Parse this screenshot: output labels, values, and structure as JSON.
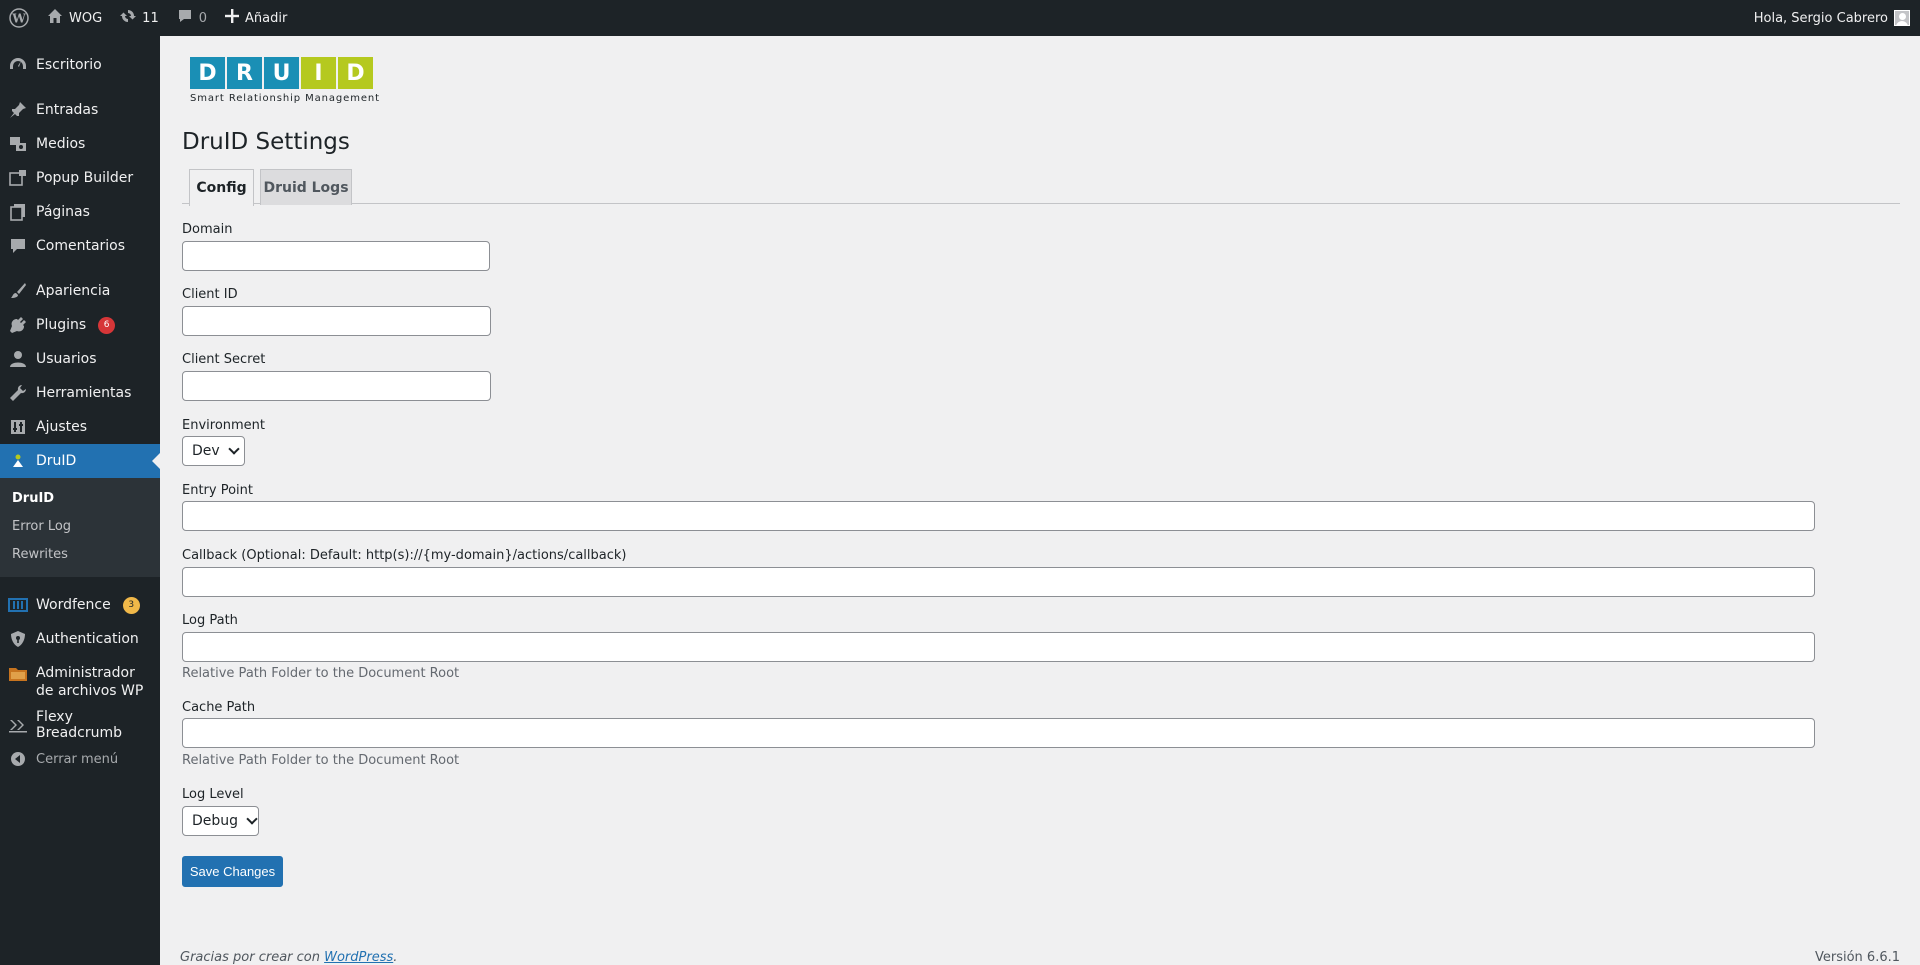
{
  "adminbar": {
    "site_name": "WOG",
    "updates_count": "11",
    "comments_count": "0",
    "add_new": "Añadir",
    "greeting": "Hola, Sergio Cabrero"
  },
  "sidebar": {
    "items": [
      {
        "label": "Escritorio",
        "icon": "dashboard-icon"
      },
      {
        "label": "Entradas",
        "icon": "pin-icon"
      },
      {
        "label": "Medios",
        "icon": "media-icon"
      },
      {
        "label": "Popup Builder",
        "icon": "popup-icon"
      },
      {
        "label": "Páginas",
        "icon": "pages-icon"
      },
      {
        "label": "Comentarios",
        "icon": "comment-icon"
      },
      {
        "label": "Apariencia",
        "icon": "brush-icon"
      },
      {
        "label": "Plugins",
        "icon": "plugin-icon",
        "badge": "6"
      },
      {
        "label": "Usuarios",
        "icon": "user-icon"
      },
      {
        "label": "Herramientas",
        "icon": "wrench-icon"
      },
      {
        "label": "Ajustes",
        "icon": "settings-icon"
      },
      {
        "label": "DruID",
        "icon": "druid-icon"
      }
    ],
    "submenu": [
      "DruID",
      "Error Log",
      "Rewrites"
    ],
    "items2": [
      {
        "label": "Wordfence",
        "icon": "wordfence-icon",
        "badge": "3"
      },
      {
        "label": "Authentication",
        "icon": "shield-icon"
      },
      {
        "label": "Administrador de archivos WP",
        "icon": "folder-icon"
      },
      {
        "label": "Flexy Breadcrumb",
        "icon": "breadcrumb-icon"
      }
    ],
    "collapse": "Cerrar menú"
  },
  "logo": {
    "letters": [
      "D",
      "R",
      "U",
      "I",
      "D"
    ],
    "colors": [
      "#1a8fb5",
      "#1a8fb5",
      "#1a8fb5",
      "#b5c91f",
      "#b5c91f"
    ],
    "tagline": "Smart Relationship Management"
  },
  "page": {
    "title": "DruID Settings",
    "tabs": [
      "Config",
      "Druid Logs"
    ]
  },
  "form": {
    "domain_label": "Domain",
    "client_id_label": "Client ID",
    "client_secret_label": "Client Secret",
    "environment_label": "Environment",
    "environment_value": "Dev",
    "entry_point_label": "Entry Point",
    "callback_label": "Callback (Optional: Default: http(s)://{my-domain}/actions/callback)",
    "log_path_label": "Log Path",
    "log_path_desc": "Relative Path Folder to the Document Root",
    "cache_path_label": "Cache Path",
    "cache_path_desc": "Relative Path Folder to the Document Root",
    "log_level_label": "Log Level",
    "log_level_value": "Debug",
    "save_label": "Save Changes"
  },
  "footer": {
    "thanks_prefix": "Gracias por crear con ",
    "wordpress_link": "WordPress",
    "thanks_suffix": ".",
    "version": "Versión 6.6.1"
  }
}
